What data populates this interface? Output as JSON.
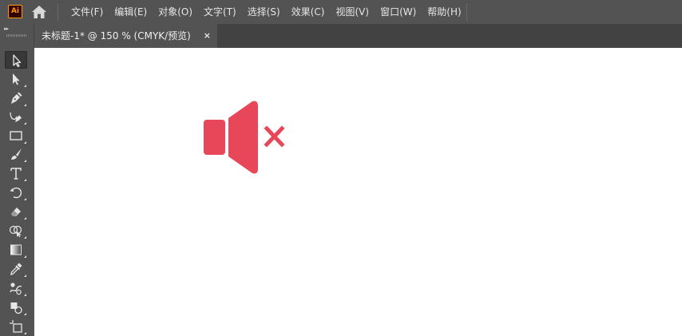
{
  "app": {
    "logo_text": "Ai",
    "menu": [
      "文件(F)",
      "编辑(E)",
      "对象(O)",
      "文字(T)",
      "选择(S)",
      "效果(C)",
      "视图(V)",
      "窗口(W)",
      "帮助(H)"
    ]
  },
  "document_tab": {
    "title": "未标题-1* @ 150 % (CMYK/预览)",
    "close_glyph": "×"
  },
  "toolbar": {
    "collapse_glyph": "▸▸",
    "tools": [
      {
        "name": "selection-tool",
        "icon": "selection-arrow-icon",
        "active": true
      },
      {
        "name": "direct-selection-tool",
        "icon": "direct-selection-arrow-icon"
      },
      {
        "name": "pen-tool",
        "icon": "pen-nib-icon"
      },
      {
        "name": "curvature-tool",
        "icon": "curvature-pen-icon"
      },
      {
        "name": "rectangle-tool",
        "icon": "rectangle-icon"
      },
      {
        "name": "paintbrush-tool",
        "icon": "paintbrush-icon"
      },
      {
        "name": "type-tool",
        "icon": "type-t-icon"
      },
      {
        "name": "rotate-tool",
        "icon": "rotate-icon"
      },
      {
        "name": "eraser-tool",
        "icon": "eraser-icon"
      },
      {
        "name": "shape-builder-tool",
        "icon": "shape-builder-icon"
      },
      {
        "name": "gradient-tool",
        "icon": "gradient-icon"
      },
      {
        "name": "eyedropper-tool",
        "icon": "eyedropper-icon"
      },
      {
        "name": "blend-tool",
        "icon": "blend-icon"
      },
      {
        "name": "live-paint-tool",
        "icon": "live-paint-bucket-icon"
      },
      {
        "name": "artboard-tool",
        "icon": "artboard-icon"
      }
    ]
  },
  "artwork": {
    "icon": "speaker-muted-icon",
    "color": "#e84659"
  },
  "colors": {
    "chrome": "#535353",
    "tab_strip": "#424242",
    "canvas": "#ffffff",
    "logo_accent": "#ff9a00"
  }
}
